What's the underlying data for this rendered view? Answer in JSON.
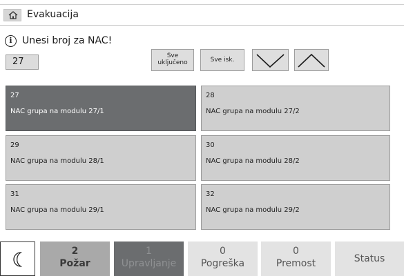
{
  "header": {
    "title": "Evakuacija",
    "home_icon": "home-icon"
  },
  "prompt": {
    "icon": "info-icon",
    "text": "Unesi broj za NAC!"
  },
  "nac_input": {
    "value": "27"
  },
  "controls": {
    "all_on_line1": "Sve",
    "all_on_line2": "uključeno",
    "all_off": "Sve isk.",
    "down_icon": "chevron-down-icon",
    "up_icon": "chevron-up-icon"
  },
  "groups": [
    {
      "number": "27",
      "label": "NAC grupa na modulu 27/1",
      "selected": true
    },
    {
      "number": "28",
      "label": "NAC grupa na modulu 27/2",
      "selected": false
    },
    {
      "number": "29",
      "label": "NAC grupa na modulu 28/1",
      "selected": false
    },
    {
      "number": "30",
      "label": "NAC grupa na modulu 28/2",
      "selected": false
    },
    {
      "number": "31",
      "label": "NAC grupa na modulu 29/1",
      "selected": false
    },
    {
      "number": "32",
      "label": "NAC grupa na modulu 29/2",
      "selected": false
    }
  ],
  "footer": {
    "night_icon": "moon-icon",
    "fire": {
      "count": "2",
      "label": "Požar"
    },
    "control": {
      "count": "1",
      "label": "Upravljanje"
    },
    "fault": {
      "count": "0",
      "label": "Pogreška"
    },
    "bypass": {
      "count": "0",
      "label": "Premost"
    },
    "status": {
      "label": "Status"
    }
  },
  "colors": {
    "selected_tile": "#6b6d6f",
    "tile": "#cfcfcf",
    "fire_button": "#a9a9a9",
    "control_button": "#6b6d6f",
    "footer_button": "#e3e3e3"
  }
}
